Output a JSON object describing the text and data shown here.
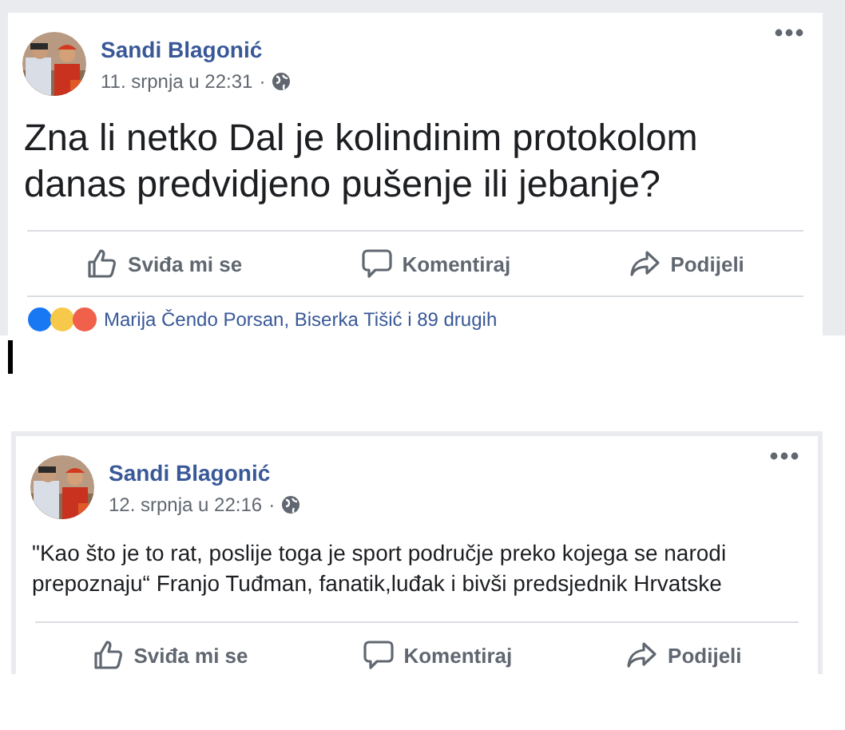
{
  "posts": [
    {
      "author": "Sandi Blagonić",
      "date": "11. srpnja u 22:31",
      "separator": "·",
      "kind": "large",
      "text": "Zna li netko Dal je kolindinim protokolom danas predvidjeno pušenje ili jebanje?",
      "actions": [
        {
          "kind": "like",
          "label": "Sviđa mi se"
        },
        {
          "kind": "comment",
          "label": "Komentiraj"
        },
        {
          "kind": "share",
          "label": "Podijeli"
        }
      ],
      "reactions": "Marija Čendo Porsan, Biserka Tišić i 89 drugih"
    },
    {
      "author": "Sandi Blagonić",
      "date": "12. srpnja u 22:16",
      "separator": "·",
      "kind": "normal",
      "text": "\"Kao što je to rat, poslije toga je sport područje preko kojega se narodi prepoznaju“ Franjo Tuđman, fanatik,luđak i bivši predsjednik Hrvatske",
      "actions": [
        {
          "kind": "like",
          "label": "Sviđa mi se"
        },
        {
          "kind": "comment",
          "label": "Komentiraj"
        },
        {
          "kind": "share",
          "label": "Podijeli"
        }
      ]
    }
  ]
}
